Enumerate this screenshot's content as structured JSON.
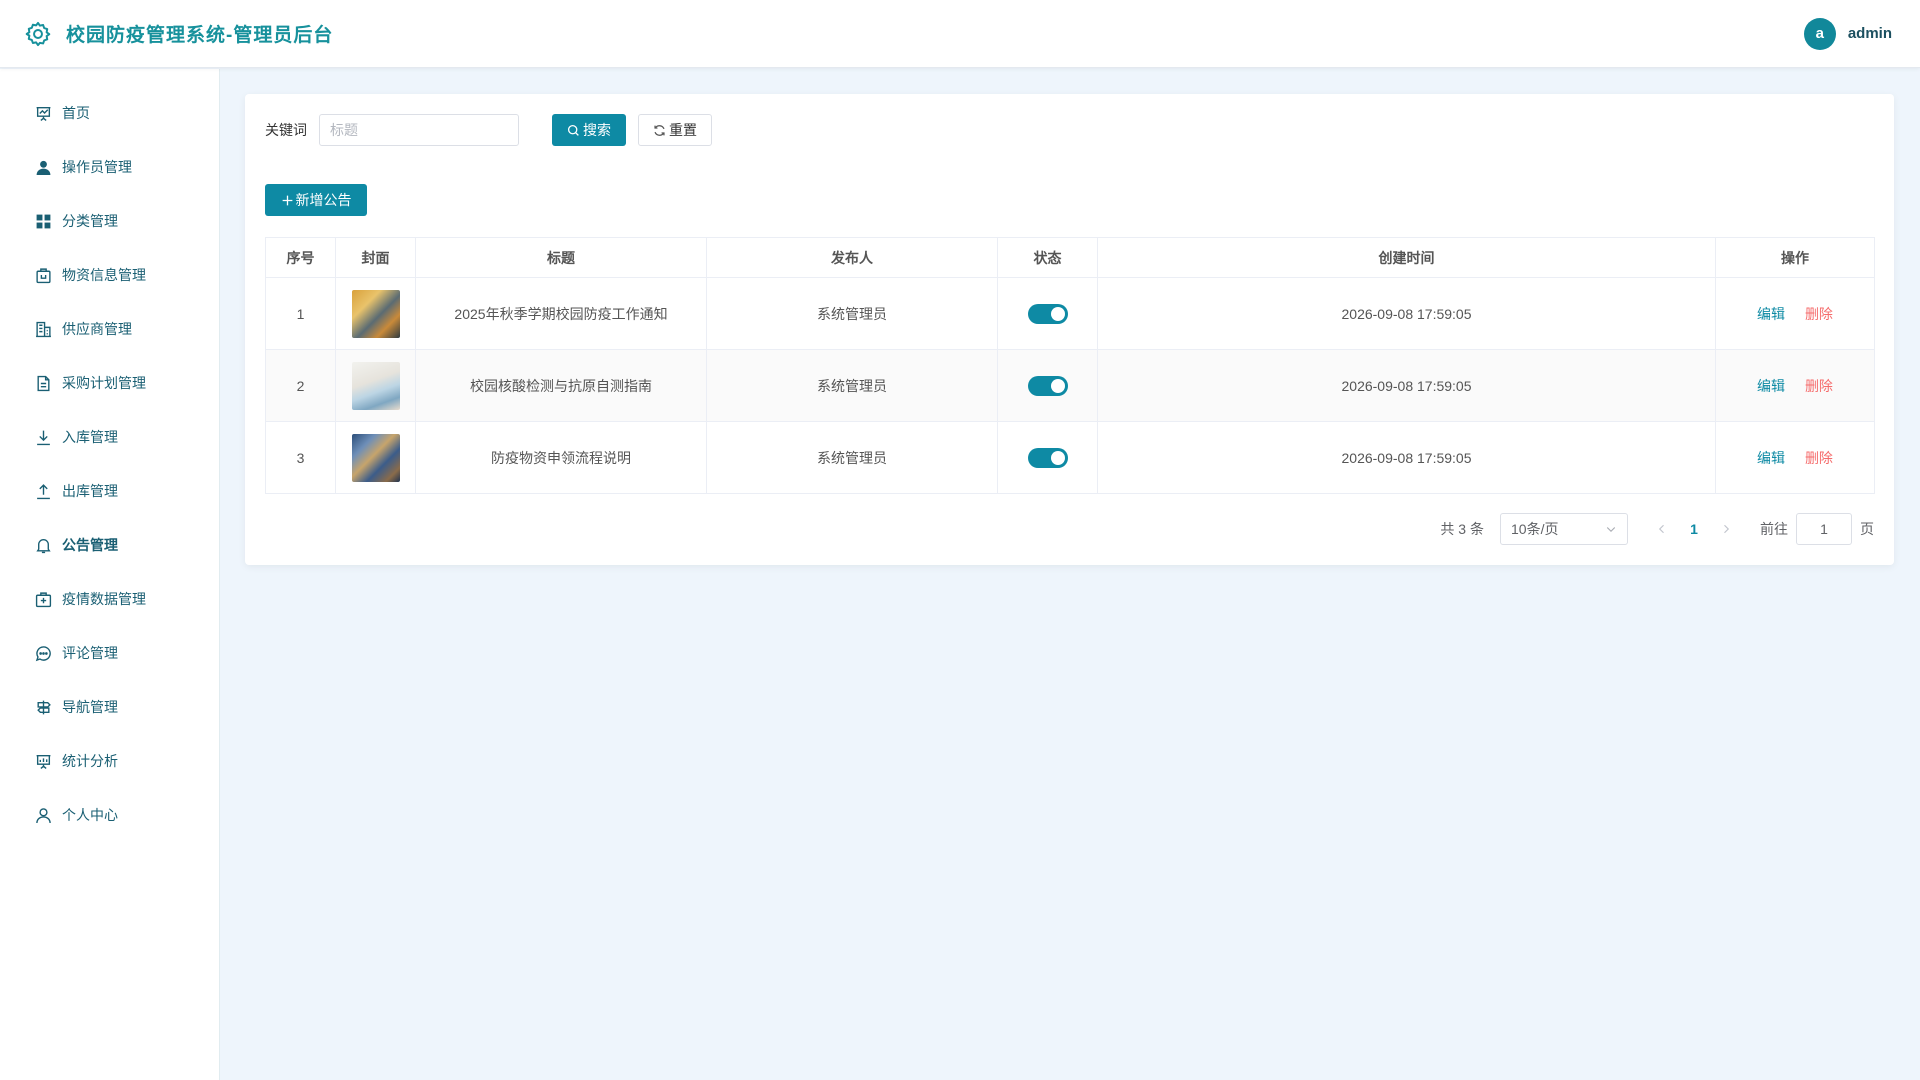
{
  "header": {
    "title": "校园防疫管理系统-管理员后台",
    "avatar_letter": "a",
    "username": "admin"
  },
  "sidebar": {
    "items": [
      {
        "label": "首页",
        "icon": "presentation-icon"
      },
      {
        "label": "操作员管理",
        "icon": "user-filled-icon"
      },
      {
        "label": "分类管理",
        "icon": "grid-icon"
      },
      {
        "label": "物资信息管理",
        "icon": "box-icon"
      },
      {
        "label": "供应商管理",
        "icon": "office-building-icon"
      },
      {
        "label": "采购计划管理",
        "icon": "document-icon"
      },
      {
        "label": "入库管理",
        "icon": "download-icon"
      },
      {
        "label": "出库管理",
        "icon": "upload-icon"
      },
      {
        "label": "公告管理",
        "icon": "bell-icon"
      },
      {
        "label": "疫情数据管理",
        "icon": "first-aid-kit-icon"
      },
      {
        "label": "评论管理",
        "icon": "chat-icon"
      },
      {
        "label": "导航管理",
        "icon": "guide-icon"
      },
      {
        "label": "统计分析",
        "icon": "data-board-icon"
      },
      {
        "label": "个人中心",
        "icon": "user-icon"
      }
    ],
    "active_index": 8
  },
  "search": {
    "label": "关键词",
    "placeholder": "标题",
    "value": "",
    "search_button": "搜索",
    "reset_button": "重置"
  },
  "actions": {
    "add_button": "新增公告"
  },
  "table": {
    "columns": [
      "序号",
      "封面",
      "标题",
      "发布人",
      "状态",
      "创建时间",
      "操作"
    ],
    "rows": [
      {
        "index": "1",
        "title": "2025年秋季学期校园防疫工作通知",
        "publisher": "系统管理员",
        "status_on": true,
        "created": "2026-09-08 17:59:05"
      },
      {
        "index": "2",
        "title": "校园核酸检测与抗原自测指南",
        "publisher": "系统管理员",
        "status_on": true,
        "created": "2026-09-08 17:59:05"
      },
      {
        "index": "3",
        "title": "防疫物资申领流程说明",
        "publisher": "系统管理员",
        "status_on": true,
        "created": "2026-09-08 17:59:05"
      }
    ],
    "edit_label": "编辑",
    "delete_label": "删除"
  },
  "pagination": {
    "total_text": "共 3 条",
    "page_size": "10条/页",
    "current_page": "1",
    "goto_label": "前往",
    "goto_value": "1",
    "page_unit": "页"
  },
  "colors": {
    "accent": "#0e8aa4",
    "brand_text": "#17919c",
    "danger": "#f56c6c",
    "background": "#eef5fc"
  }
}
